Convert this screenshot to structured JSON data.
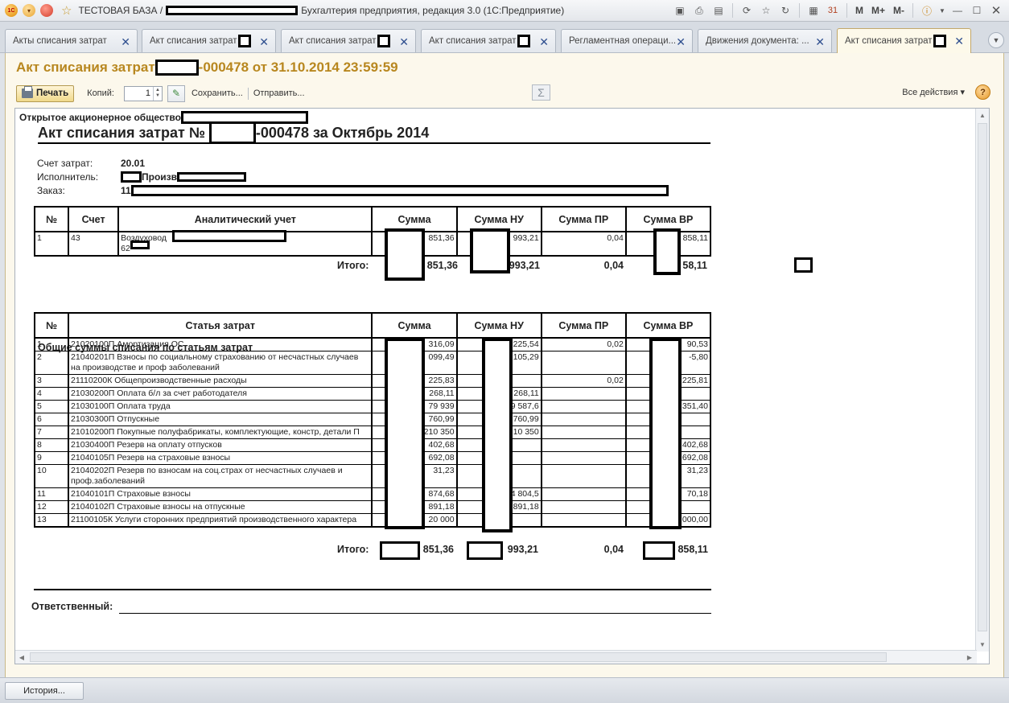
{
  "window": {
    "title_prefix": "ТЕСТОВАЯ БАЗА /",
    "title_suffix": "Бухгалтерия предприятия, редакция 3.0  (1С:Предприятие)",
    "toolbar_memory": [
      "M",
      "M+",
      "M-"
    ]
  },
  "tabs": [
    {
      "label": "Акты списания затрат"
    },
    {
      "label": "Акт списания затрат"
    },
    {
      "label": "Акт списания затрат"
    },
    {
      "label": "Акт списания затрат"
    },
    {
      "label": "Регламентная операци..."
    },
    {
      "label": "Движения документа: ..."
    },
    {
      "label": "Акт списания затрат"
    }
  ],
  "form": {
    "title_prefix": "Акт списания затрат",
    "title_suffix": "-000478 от 31.10.2014 23:59:59"
  },
  "cmdbar": {
    "print": "Печать",
    "copies_label": "Копий:",
    "copies_value": "1",
    "save": "Сохранить...",
    "send": "Отправить...",
    "sigma": "Σ",
    "all_actions": "Все действия",
    "help": "?"
  },
  "doc": {
    "org_prefix": "Открытое акционерное общество",
    "head_prefix": "Акт списания затрат №",
    "head_suffix": "-000478 за Октябрь 2014",
    "account_label": "Счет затрат:",
    "account_value": "20.01",
    "executor_label": "Исполнитель:",
    "executor_value": "Произв",
    "order_label": "Заказ:",
    "order_value": "11",
    "table1": {
      "headers": [
        "№",
        "Счет",
        "Аналитический учет",
        "Сумма",
        "Сумма НУ",
        "Сумма ПР",
        "Сумма ВР"
      ],
      "row": {
        "n": "1",
        "acc": "43",
        "analytics_1": "Воздуховод",
        "analytics_2": "62",
        "sum": "851,36",
        "sum_nu": "993,21",
        "sum_pr": "0,04",
        "sum_vr": "858,11"
      }
    },
    "total_label": "Итого:",
    "total1": {
      "sum": "851,36",
      "sum_nu": "993,21",
      "sum_pr": "0,04",
      "sum_vr": "58,11"
    },
    "section_title": "Общие суммы списания по статьям затрат",
    "table2": {
      "headers": [
        "№",
        "Статья затрат",
        "Сумма",
        "Сумма НУ",
        "Сумма ПР",
        "Сумма ВР"
      ],
      "rows": [
        {
          "n": "1",
          "item": "21020100П Амортизация ОС",
          "sum": "316,09",
          "nu": "225,54",
          "pr": "0,02",
          "vr": "90,53"
        },
        {
          "n": "2",
          "item": "21040201П Взносы по социальному страхованию от несчастных случаев на производстве и проф заболеваний",
          "sum": "099,49",
          "nu": "105,29",
          "pr": "",
          "vr": "-5,80"
        },
        {
          "n": "3",
          "item": "21110200К Общепроизводственные расходы",
          "sum": "225,83",
          "nu": "",
          "pr": "0,02",
          "vr": "225,81"
        },
        {
          "n": "4",
          "item": "21030200П Оплата б/л за счет работодателя",
          "sum": "268,11",
          "nu": "268,11",
          "pr": "",
          "vr": ""
        },
        {
          "n": "5",
          "item": "21030100П Оплата труда",
          "sum": "79 939",
          "nu": "9 587,6",
          "pr": "",
          "vr": "351,40"
        },
        {
          "n": "6",
          "item": "21030300П Отпускные",
          "sum": "760,99",
          "nu": "760,99",
          "pr": "",
          "vr": ""
        },
        {
          "n": "7",
          "item": "21010200П Покупные полуфабрикаты, комплектующие, констр, детали П",
          "sum": "210 350",
          "nu": "10 350",
          "pr": "",
          "vr": ""
        },
        {
          "n": "8",
          "item": "21030400П Резерв на оплату отпусков",
          "sum": "402,68",
          "nu": "",
          "pr": "",
          "vr": "402,68"
        },
        {
          "n": "9",
          "item": "21040105П Резерв на страховые взносы",
          "sum": "692,08",
          "nu": "",
          "pr": "",
          "vr": "692,08"
        },
        {
          "n": "10",
          "item": "21040202П Резерв по взносам на  соц.страх от несчастных случаев и проф.заболеваний",
          "sum": "31,23",
          "nu": "",
          "pr": "",
          "vr": "31,23"
        },
        {
          "n": "11",
          "item": "21040101П Страховые взносы",
          "sum": "874,68",
          "nu": "4 804,5",
          "pr": "",
          "vr": "70,18"
        },
        {
          "n": "12",
          "item": "21040102П Страховые взносы на отпускные",
          "sum": "891,18",
          "nu": "891,18",
          "pr": "",
          "vr": ""
        },
        {
          "n": "13",
          "item": "21100105К Услуги сторонних предприятий производственного характера",
          "sum": "20 000",
          "nu": "",
          "pr": "",
          "vr": "000,00"
        }
      ]
    },
    "total2": {
      "sum": "851,36",
      "sum_nu": "993,21",
      "sum_pr": "0,04",
      "sum_vr": "858,11"
    },
    "responsible_label": "Ответственный:"
  },
  "bottom": {
    "history": "История..."
  },
  "colors": {
    "title_gold": "#b8871f",
    "form_bg": "#fcf8ec"
  }
}
